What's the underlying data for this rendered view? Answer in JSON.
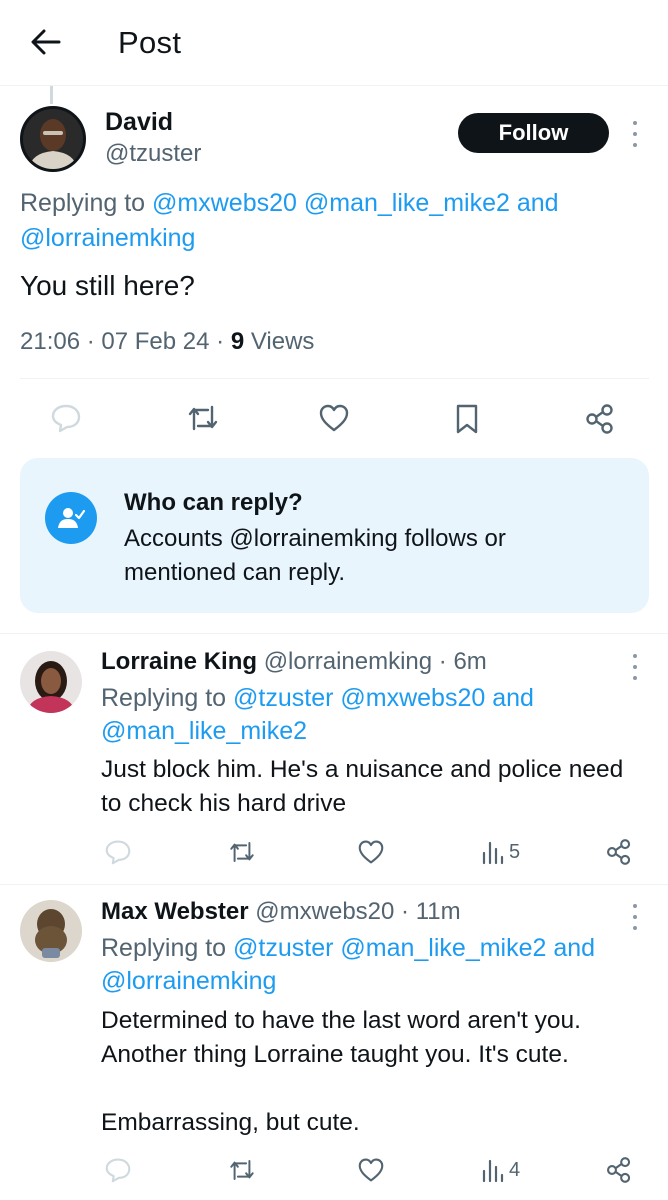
{
  "header": {
    "title": "Post",
    "back_icon": "arrow-left-icon"
  },
  "post": {
    "author": {
      "name": "David",
      "handle": "@tzuster"
    },
    "follow_label": "Follow",
    "replying_prefix": "Replying to",
    "replying_mentions": [
      "@mxwebs20",
      "@man_like_mike2"
    ],
    "replying_and": "and",
    "replying_last": "@lorrainemking",
    "text": "You still here?",
    "time": "21:06",
    "date": "07 Feb 24",
    "views_count": "9",
    "views_label": "Views"
  },
  "who_can_reply": {
    "title": "Who can reply?",
    "body": "Accounts @lorrainemking follows or mentioned can reply."
  },
  "replies": [
    {
      "name": "Lorraine King",
      "handle": "@lorrainemking",
      "time": "6m",
      "replying_prefix": "Replying to",
      "replying_first": "@tzuster",
      "replying_second": "@mxwebs20",
      "replying_and": "and",
      "replying_last": "@man_like_mike2",
      "text": "Just block him. He's a nuisance and police need to check his hard drive",
      "views": "5"
    },
    {
      "name": "Max Webster",
      "handle": "@mxwebs20",
      "time": "11m",
      "replying_prefix": "Replying to",
      "replying_first": "@tzuster",
      "replying_second": "@man_like_mike2",
      "replying_and": "and",
      "replying_last": "@lorrainemking",
      "text": "Determined to have the last word aren't you. Another thing Lorraine taught you. It's cute.\n\nEmbarrassing, but cute.",
      "views": "4"
    }
  ],
  "colors": {
    "accent": "#1d9bf0",
    "text": "#0f1419",
    "secondary": "#536471",
    "card_bg": "#e8f5fd"
  }
}
